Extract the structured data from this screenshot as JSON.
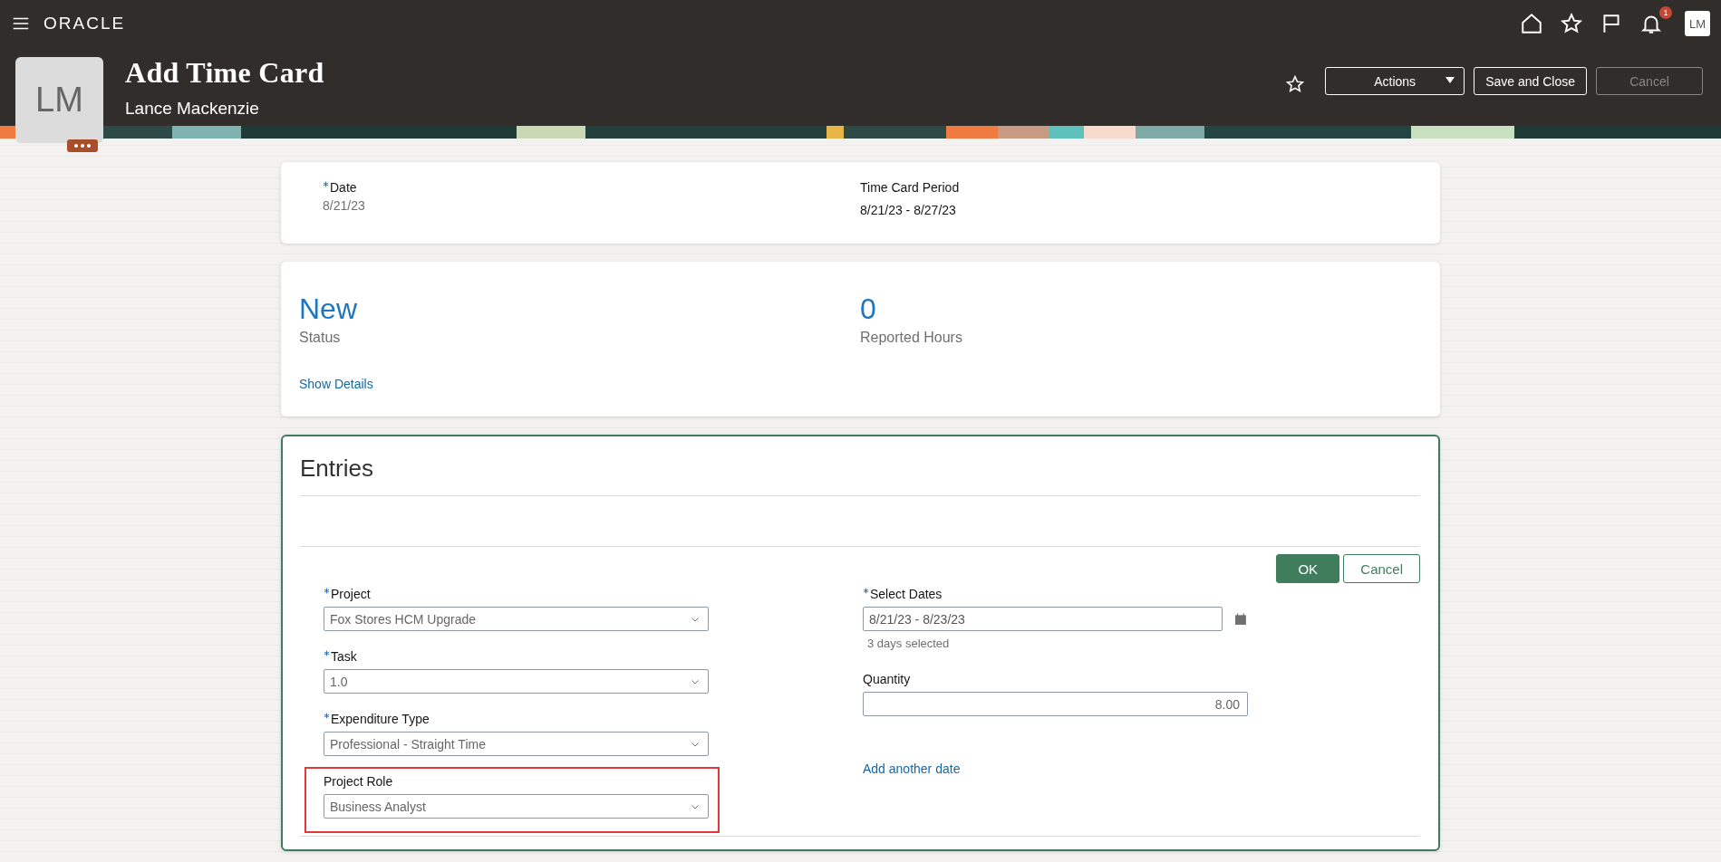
{
  "topbar": {
    "logo": "ORACLE",
    "notification_count": "1",
    "user_initials": "LM"
  },
  "page_header": {
    "avatar_initials": "LM",
    "title": "Add Time Card",
    "subtitle": "Lance Mackenzie",
    "buttons": [
      {
        "label": "Actions",
        "kind": "menu",
        "disabled": false
      },
      {
        "label": "Save and Close",
        "kind": "plain",
        "disabled": false
      },
      {
        "label": "Cancel",
        "kind": "plain",
        "disabled": true
      }
    ]
  },
  "summary": {
    "fields": [
      {
        "label": "Date",
        "required": true,
        "value": "8/21/23"
      },
      {
        "label": "Time Card Period",
        "required": false,
        "value": "8/21/23 - 8/27/23"
      }
    ]
  },
  "status_card": {
    "metrics": [
      {
        "value": "New",
        "label": "Status"
      },
      {
        "value": "0",
        "label": "Reported Hours"
      }
    ],
    "link": "Show Details"
  },
  "entries": {
    "title": "Entries",
    "buttons": [
      {
        "label": "OK",
        "kind": "primary"
      },
      {
        "label": "Cancel",
        "kind": "secondary"
      }
    ],
    "left_fields": [
      {
        "label": "Project",
        "required": true,
        "value": "Fox Stores HCM Upgrade",
        "kind": "select",
        "highlighted": false
      },
      {
        "label": "Task",
        "required": true,
        "value": "1.0",
        "kind": "select",
        "highlighted": false
      },
      {
        "label": "Expenditure Type",
        "required": true,
        "value": "Professional - Straight Time",
        "kind": "select",
        "highlighted": false
      },
      {
        "label": "Project Role",
        "required": false,
        "value": "Business Analyst",
        "kind": "select",
        "highlighted": true
      }
    ],
    "right_fields": [
      {
        "label": "Select Dates",
        "required": true,
        "value": "8/21/23 - 8/23/23",
        "kind": "date",
        "hint": "3 days selected"
      },
      {
        "label": "Quantity",
        "required": false,
        "value": "8.00",
        "kind": "number"
      }
    ],
    "link": "Add another date"
  }
}
